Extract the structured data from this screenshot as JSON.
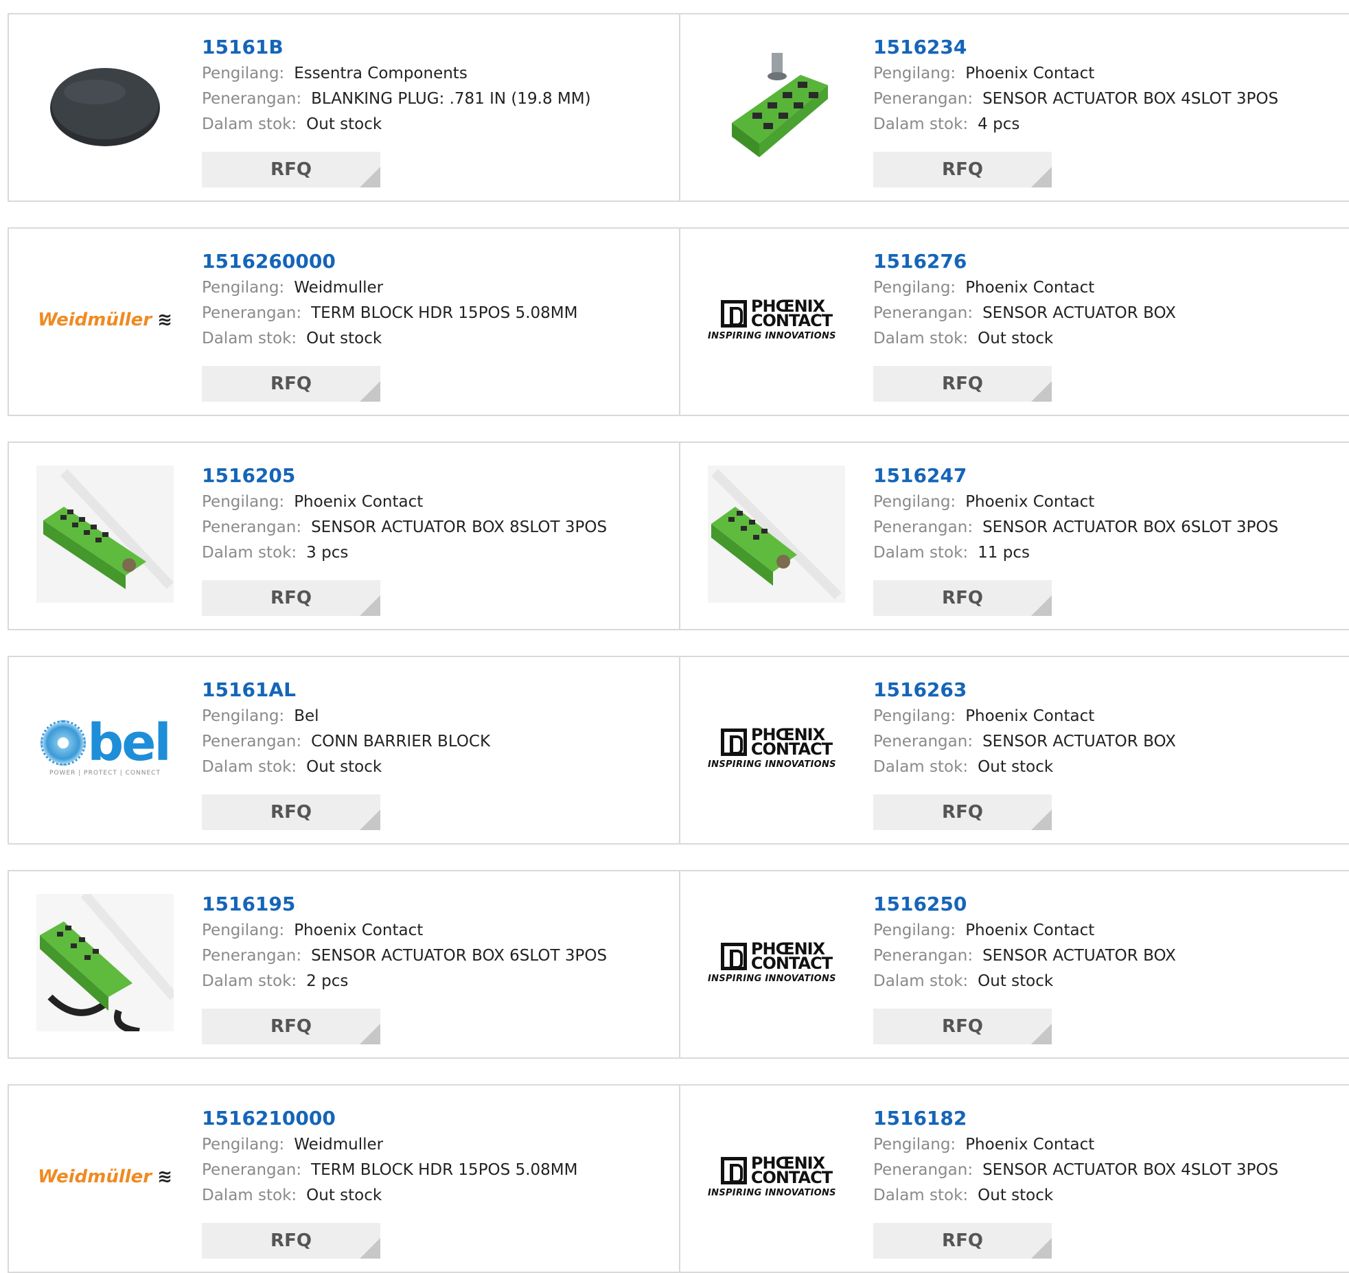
{
  "labels": {
    "manufacturer": "Pengilang:",
    "description": "Penerangan:",
    "stock": "Dalam stok:",
    "rfq": "RFQ"
  },
  "logos": {
    "weidmuller": {
      "text": "Weidmüller",
      "mark": "≋",
      "color": "#f08a22"
    },
    "phoenix": {
      "line1": "PHŒNIX",
      "line2": "CONTACT",
      "tagline": "INSPIRING INNOVATIONS"
    },
    "bel": {
      "text": "bel",
      "tagline": "POWER | PROTECT | CONNECT",
      "color": "#1e8ed8"
    }
  },
  "products": [
    {
      "part": "15161B",
      "manufacturer": "Essentra Components",
      "description": "BLANKING PLUG: .781 IN (19.8 MM)",
      "stock": "Out stock",
      "image": "blanking-plug-photo"
    },
    {
      "part": "1516234",
      "manufacturer": "Phoenix Contact",
      "description": "SENSOR ACTUATOR BOX 4SLOT 3POS",
      "stock": "4 pcs",
      "image": "sensor-box-4slot-photo"
    },
    {
      "part": "1516260000",
      "manufacturer": "Weidmuller",
      "description": "TERM BLOCK HDR 15POS 5.08MM",
      "stock": "Out stock",
      "image": "weidmuller-logo"
    },
    {
      "part": "1516276",
      "manufacturer": "Phoenix Contact",
      "description": "SENSOR ACTUATOR BOX",
      "stock": "Out stock",
      "image": "phoenix-contact-logo"
    },
    {
      "part": "1516205",
      "manufacturer": "Phoenix Contact",
      "description": "SENSOR ACTUATOR BOX 8SLOT 3POS",
      "stock": "3 pcs",
      "image": "sensor-box-8slot-photo"
    },
    {
      "part": "1516247",
      "manufacturer": "Phoenix Contact",
      "description": "SENSOR ACTUATOR BOX 6SLOT 3POS",
      "stock": "11 pcs",
      "image": "sensor-box-6slot-photo"
    },
    {
      "part": "15161AL",
      "manufacturer": "Bel",
      "description": "CONN BARRIER BLOCK",
      "stock": "Out stock",
      "image": "bel-logo"
    },
    {
      "part": "1516263",
      "manufacturer": "Phoenix Contact",
      "description": "SENSOR ACTUATOR BOX",
      "stock": "Out stock",
      "image": "phoenix-contact-logo"
    },
    {
      "part": "1516195",
      "manufacturer": "Phoenix Contact",
      "description": "SENSOR ACTUATOR BOX 6SLOT 3POS",
      "stock": "2 pcs",
      "image": "sensor-box-cable-photo"
    },
    {
      "part": "1516250",
      "manufacturer": "Phoenix Contact",
      "description": "SENSOR ACTUATOR BOX",
      "stock": "Out stock",
      "image": "phoenix-contact-logo"
    },
    {
      "part": "1516210000",
      "manufacturer": "Weidmuller",
      "description": "TERM BLOCK HDR 15POS 5.08MM",
      "stock": "Out stock",
      "image": "weidmuller-logo"
    },
    {
      "part": "1516182",
      "manufacturer": "Phoenix Contact",
      "description": "SENSOR ACTUATOR BOX 4SLOT 3POS",
      "stock": "Out stock",
      "image": "phoenix-contact-logo"
    }
  ]
}
